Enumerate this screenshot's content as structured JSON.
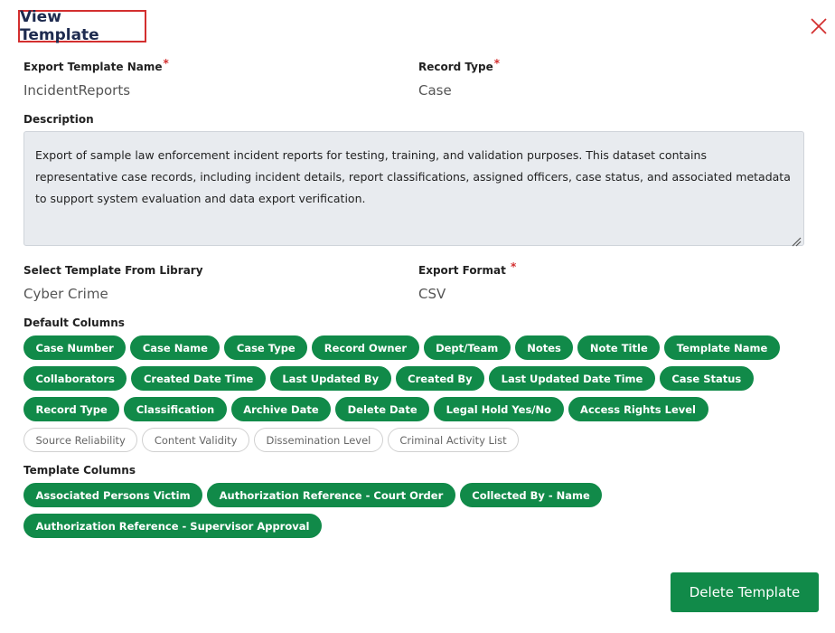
{
  "header": {
    "title": "View Template"
  },
  "form": {
    "export_template_name": {
      "label": "Export Template Name",
      "required": "*",
      "value": "IncidentReports"
    },
    "record_type": {
      "label": "Record Type",
      "required": "*",
      "value": "Case"
    },
    "description": {
      "label": "Description",
      "value": "Export of sample law enforcement incident reports for testing, training, and validation purposes. This dataset contains representative case records, including incident details, report classifications, assigned officers, case status, and associated metadata to support system evaluation and data export verification."
    },
    "template_library": {
      "label": "Select Template From Library",
      "value": "Cyber Crime"
    },
    "export_format": {
      "label": "Export Format",
      "required": "*",
      "value": "CSV"
    }
  },
  "default_columns": {
    "label": "Default Columns",
    "chips": [
      {
        "label": "Case Number",
        "selected": true
      },
      {
        "label": "Case Name",
        "selected": true
      },
      {
        "label": "Case Type",
        "selected": true
      },
      {
        "label": "Record Owner",
        "selected": true
      },
      {
        "label": "Dept/Team",
        "selected": true
      },
      {
        "label": "Notes",
        "selected": true
      },
      {
        "label": "Note Title",
        "selected": true
      },
      {
        "label": "Template Name",
        "selected": true
      },
      {
        "label": "Collaborators",
        "selected": true
      },
      {
        "label": "Created Date Time",
        "selected": true
      },
      {
        "label": "Last Updated By",
        "selected": true
      },
      {
        "label": "Created By",
        "selected": true
      },
      {
        "label": "Last Updated Date Time",
        "selected": true
      },
      {
        "label": "Case Status",
        "selected": true
      },
      {
        "label": "Record Type",
        "selected": true
      },
      {
        "label": "Classification",
        "selected": true
      },
      {
        "label": "Archive Date",
        "selected": true
      },
      {
        "label": "Delete Date",
        "selected": true
      },
      {
        "label": "Legal Hold Yes/No",
        "selected": true
      },
      {
        "label": "Access Rights Level",
        "selected": true
      },
      {
        "label": "Source Reliability",
        "selected": false
      },
      {
        "label": "Content Validity",
        "selected": false
      },
      {
        "label": "Dissemination Level",
        "selected": false
      },
      {
        "label": "Criminal Activity List",
        "selected": false
      }
    ]
  },
  "template_columns": {
    "label": "Template Columns",
    "chips": [
      {
        "label": "Associated Persons Victim",
        "selected": true
      },
      {
        "label": "Authorization Reference - Court Order",
        "selected": true
      },
      {
        "label": "Collected By - Name",
        "selected": true
      },
      {
        "label": "Authorization Reference - Supervisor Approval",
        "selected": true
      }
    ]
  },
  "actions": {
    "delete_label": "Delete Template"
  },
  "colors": {
    "accent": "#118a49",
    "title_border": "#d32f2f",
    "title_text": "#1e2b4f",
    "required": "#d32f2f"
  }
}
